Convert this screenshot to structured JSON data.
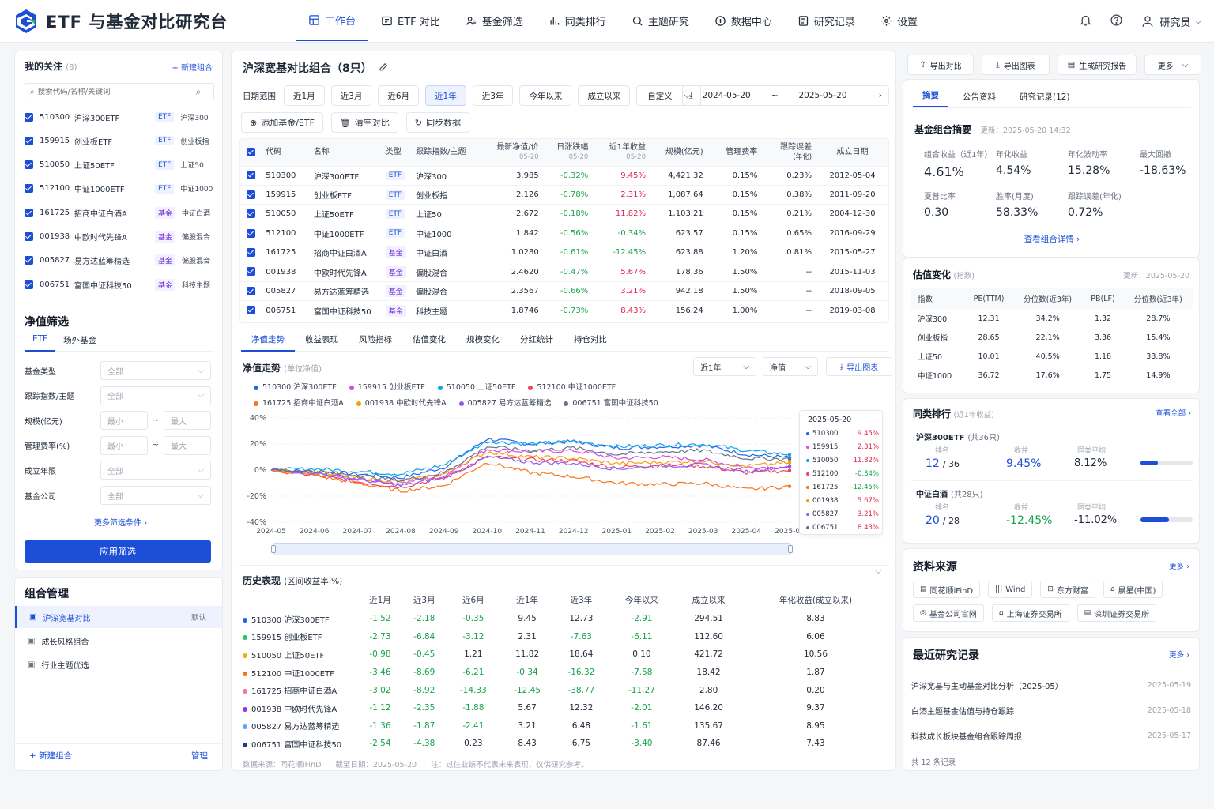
{
  "app": {
    "title": "ETF 与基金对比研究台"
  },
  "nav": [
    {
      "label": "工作台",
      "icon": "dashboard-icon",
      "active": true
    },
    {
      "label": "ETF 对比",
      "icon": "compare-icon"
    },
    {
      "label": "基金筛选",
      "icon": "filter-people-icon"
    },
    {
      "label": "同类排行",
      "icon": "bar-chart-icon"
    },
    {
      "label": "主题研究",
      "icon": "search-icon"
    },
    {
      "label": "数据中心",
      "icon": "database-icon"
    },
    {
      "label": "研究记录",
      "icon": "notebook-icon"
    },
    {
      "label": "设置",
      "icon": "gear-icon"
    }
  ],
  "user": {
    "name": "研究员"
  },
  "watchlist": {
    "title": "我的关注",
    "count": "(8)",
    "new_group": "+ 新建组合",
    "search_placeholder": "搜索代码/名称/关键词",
    "items": [
      {
        "code": "510300",
        "name": "沪深300ETF",
        "tag": "ETF",
        "kind": "etf",
        "index": "沪深300"
      },
      {
        "code": "159915",
        "name": "创业板ETF",
        "tag": "ETF",
        "kind": "etf",
        "index": "创业板指"
      },
      {
        "code": "510050",
        "name": "上证50ETF",
        "tag": "ETF",
        "kind": "etf",
        "index": "上证50"
      },
      {
        "code": "512100",
        "name": "中证1000ETF",
        "tag": "ETF",
        "kind": "etf",
        "index": "中证1000"
      },
      {
        "code": "161725",
        "name": "招商中证白酒A",
        "tag": "基金",
        "kind": "fund",
        "index": "中证白酒"
      },
      {
        "code": "001938",
        "name": "中欧时代先锋A",
        "tag": "基金",
        "kind": "fund",
        "index": "偏股混合"
      },
      {
        "code": "005827",
        "name": "易方达蓝筹精选",
        "tag": "基金",
        "kind": "fund",
        "index": "偏股混合"
      },
      {
        "code": "006751",
        "name": "富国中证科技50",
        "tag": "基金",
        "kind": "fund",
        "index": "科技主题"
      }
    ]
  },
  "filter": {
    "title": "净值筛选",
    "tabs": [
      "ETF",
      "场外基金"
    ],
    "rows": [
      {
        "label": "基金类型",
        "value": "全部"
      },
      {
        "label": "跟踪指数/主题",
        "value": "全部"
      },
      {
        "label": "规模(亿元)",
        "min": "最小",
        "max": "最大"
      },
      {
        "label": "管理费率(%)",
        "min": "最小",
        "max": "最大"
      },
      {
        "label": "成立年限",
        "value": "全部"
      },
      {
        "label": "基金公司",
        "value": "全部"
      }
    ],
    "more": "更多筛选条件 ›",
    "apply": "应用筛选",
    "range_sep": "~"
  },
  "groups": {
    "title": "组合管理",
    "items": [
      {
        "name": "沪深宽基对比",
        "badge": "默认",
        "active": true
      },
      {
        "name": "成长风格组合",
        "badge": ""
      },
      {
        "name": "行业主题优选",
        "badge": ""
      }
    ],
    "new": "+ 新建组合",
    "manage": "管理"
  },
  "main": {
    "title": "沪深宽基对比组合（8只）",
    "date_label": "日期范围",
    "ranges": [
      "近1月",
      "近3月",
      "近6月",
      "近1年",
      "近3年",
      "今年以来",
      "成立以来",
      "自定义"
    ],
    "active_range": 3,
    "date_from": "2024-05-20",
    "date_sep": "~",
    "date_to": "2025-05-20",
    "actions": [
      "添加基金/ETF",
      "清空对比",
      "同步数据"
    ],
    "table_headers": [
      "代码",
      "名称",
      "类型",
      "跟踪指数/主题",
      "最新净值/价",
      "日涨跌幅",
      "近1年收益",
      "规模(亿元)",
      "管理费率",
      "跟踪误差",
      "成立日期"
    ],
    "table_subheaders": {
      "nav": "05-20",
      "day": "05-20",
      "y1": "05-20",
      "te": "(年化)"
    },
    "rows": [
      {
        "code": "510300",
        "name": "沪深300ETF",
        "type": "ETF",
        "kind": "etf",
        "index": "沪深300",
        "nav": "3.985",
        "day": "-0.32%",
        "y1": "9.45%",
        "y1c": "up",
        "size": "4,421.32",
        "fee": "0.15%",
        "te": "0.23%",
        "date": "2012-05-04"
      },
      {
        "code": "159915",
        "name": "创业板ETF",
        "type": "ETF",
        "kind": "etf",
        "index": "创业板指",
        "nav": "2.126",
        "day": "-0.78%",
        "y1": "2.31%",
        "y1c": "up",
        "size": "1,087.64",
        "fee": "0.15%",
        "te": "0.38%",
        "date": "2011-09-20"
      },
      {
        "code": "510050",
        "name": "上证50ETF",
        "type": "ETF",
        "kind": "etf",
        "index": "上证50",
        "nav": "2.672",
        "day": "-0.18%",
        "y1": "11.82%",
        "y1c": "up",
        "size": "1,103.21",
        "fee": "0.15%",
        "te": "0.21%",
        "date": "2004-12-30"
      },
      {
        "code": "512100",
        "name": "中证1000ETF",
        "type": "ETF",
        "kind": "etf",
        "index": "中证1000",
        "nav": "1.842",
        "day": "-0.56%",
        "y1": "-0.34%",
        "y1c": "down",
        "size": "623.57",
        "fee": "0.15%",
        "te": "0.65%",
        "date": "2016-09-29"
      },
      {
        "code": "161725",
        "name": "招商中证白酒A",
        "type": "基金",
        "kind": "fund",
        "index": "中证白酒",
        "nav": "1.0280",
        "day": "-0.61%",
        "y1": "-12.45%",
        "y1c": "down",
        "size": "623.88",
        "fee": "1.20%",
        "te": "0.81%",
        "date": "2015-05-27"
      },
      {
        "code": "001938",
        "name": "中欧时代先锋A",
        "type": "基金",
        "kind": "fund",
        "index": "偏股混合",
        "nav": "2.4620",
        "day": "-0.47%",
        "y1": "5.67%",
        "y1c": "up",
        "size": "178.36",
        "fee": "1.50%",
        "te": "--",
        "date": "2015-11-03"
      },
      {
        "code": "005827",
        "name": "易方达蓝筹精选",
        "type": "基金",
        "kind": "fund",
        "index": "偏股混合",
        "nav": "2.3567",
        "day": "-0.66%",
        "y1": "3.21%",
        "y1c": "up",
        "size": "942.18",
        "fee": "1.50%",
        "te": "--",
        "date": "2018-09-05"
      },
      {
        "code": "006751",
        "name": "富国中证科技50",
        "type": "基金",
        "kind": "fund",
        "index": "科技主题",
        "nav": "1.8746",
        "day": "-0.73%",
        "y1": "8.43%",
        "y1c": "up",
        "size": "156.24",
        "fee": "1.00%",
        "te": "--",
        "date": "2019-03-08"
      }
    ],
    "subtabs": [
      "净值走势",
      "收益表现",
      "风险指标",
      "估值变化",
      "规模变化",
      "分红统计",
      "持仓对比"
    ],
    "chart_title": "净值走势",
    "chart_unit": "(单位净值)",
    "chart_period": "近1年",
    "chart_mode": "净值",
    "export_chart": "导出图表",
    "tooltip_date": "2025-05-20",
    "history_title": "历史表现",
    "history_unit": "(区间收益率 %)",
    "history_headers": [
      "近1月",
      "近3月",
      "近6月",
      "近1年",
      "近3年",
      "今年以来",
      "成立以来",
      "年化收益(成立以来)"
    ],
    "history_rows": [
      {
        "name": "510300 沪深300ETF",
        "color": "#2563eb",
        "v": [
          "-1.52",
          "-2.18",
          "-0.35",
          "9.45",
          "12.73",
          "-2.91",
          "294.51",
          "8.83"
        ]
      },
      {
        "name": "159915 创业板ETF",
        "color": "#22c55e",
        "v": [
          "-2.73",
          "-6.84",
          "-3.12",
          "2.31",
          "-7.63",
          "-6.11",
          "112.60",
          "6.06"
        ]
      },
      {
        "name": "510050 上证50ETF",
        "color": "#eab308",
        "v": [
          "-0.98",
          "-0.45",
          "1.21",
          "11.82",
          "18.64",
          "0.10",
          "421.72",
          "10.56"
        ]
      },
      {
        "name": "512100 中证1000ETF",
        "color": "#f97316",
        "v": [
          "-3.46",
          "-8.69",
          "-6.21",
          "-0.34",
          "-16.32",
          "-7.58",
          "18.42",
          "1.87"
        ]
      },
      {
        "name": "161725 招商中证白酒A",
        "color": "#e879a8",
        "v": [
          "-3.02",
          "-8.92",
          "-14.33",
          "-12.45",
          "-38.77",
          "-11.27",
          "2.80",
          "0.20"
        ]
      },
      {
        "name": "001938 中欧时代先锋A",
        "color": "#9333ea",
        "v": [
          "-1.12",
          "-2.35",
          "-1.88",
          "5.67",
          "12.32",
          "-2.01",
          "146.20",
          "9.37"
        ]
      },
      {
        "name": "005827 易方达蓝筹精选",
        "color": "#60a5fa",
        "v": [
          "-1.36",
          "-1.87",
          "-2.41",
          "3.21",
          "6.48",
          "-1.61",
          "135.67",
          "8.95"
        ]
      },
      {
        "name": "006751 富国中证科技50",
        "color": "#1e3a8a",
        "v": [
          "-2.54",
          "-4.38",
          "0.23",
          "8.43",
          "6.75",
          "-3.40",
          "87.46",
          "7.43"
        ]
      }
    ],
    "footer": {
      "source": "数据来源：同花顺iFinD",
      "cutoff": "截至日期：2025-05-20",
      "note": "注：过往业绩不代表未来表现，仅供研究参考。"
    }
  },
  "chart_data": {
    "type": "line",
    "ylim": [
      -40,
      40
    ],
    "yticks": [
      "40%",
      "20%",
      "0%",
      "-20%",
      "-40%"
    ],
    "x_labels": [
      "2024-05",
      "2024-06",
      "2024-07",
      "2024-08",
      "2024-09",
      "2024-10",
      "2024-11",
      "2024-12",
      "2025-01",
      "2025-02",
      "2025-03",
      "2025-04",
      "2025-05"
    ],
    "series": [
      {
        "name": "510300 沪深300ETF",
        "short": "510300",
        "color": "#2563eb",
        "last": "9.45%",
        "lastc": "up",
        "values": [
          0,
          -1,
          -3,
          -6,
          2,
          24,
          20,
          22,
          17,
          18,
          19,
          12,
          9.45
        ]
      },
      {
        "name": "159915 创业板ETF",
        "short": "159915",
        "color": "#d946ef",
        "last": "2.31%",
        "lastc": "up",
        "values": [
          0,
          -3,
          -7,
          -10,
          -4,
          16,
          14,
          15,
          9,
          10,
          8,
          2,
          2.31
        ]
      },
      {
        "name": "510050 上证50ETF",
        "short": "510050",
        "color": "#0ea5e9",
        "last": "11.82%",
        "lastc": "up",
        "values": [
          0,
          1,
          -1,
          -3,
          4,
          22,
          20,
          22,
          18,
          19,
          20,
          15,
          11.82
        ]
      },
      {
        "name": "512100 中证1000ETF",
        "short": "512100",
        "color": "#f43f5e",
        "last": "-0.34%",
        "lastc": "down",
        "values": [
          0,
          -4,
          -9,
          -13,
          -6,
          10,
          8,
          7,
          2,
          4,
          3,
          -2,
          -0.34
        ]
      },
      {
        "name": "161725 招商中证白酒A",
        "short": "161725",
        "color": "#f97316",
        "last": "-12.45%",
        "lastc": "down",
        "values": [
          0,
          -4,
          -10,
          -16,
          -12,
          6,
          -2,
          -5,
          -10,
          -11,
          -10,
          -15,
          -12.45
        ]
      },
      {
        "name": "001938 中欧时代先锋A",
        "short": "001938",
        "color": "#f59e0b",
        "last": "5.67%",
        "lastc": "up",
        "values": [
          0,
          -2,
          -6,
          -9,
          -3,
          14,
          10,
          9,
          5,
          6,
          7,
          3,
          5.67
        ]
      },
      {
        "name": "005827 易方达蓝筹精选",
        "short": "005827",
        "color": "#8b5cf6",
        "last": "3.21%",
        "lastc": "up",
        "values": [
          0,
          -2,
          -7,
          -12,
          -6,
          10,
          6,
          5,
          1,
          3,
          4,
          -1,
          3.21
        ]
      },
      {
        "name": "006751 富国中证科技50",
        "short": "006751",
        "color": "#64748b",
        "last": "8.43%",
        "lastc": "up",
        "values": [
          0,
          -1,
          -4,
          -8,
          -2,
          18,
          15,
          17,
          12,
          14,
          15,
          9,
          8.43
        ]
      }
    ]
  },
  "right": {
    "actions": [
      "导出对比",
      "导出图表",
      "生成研究报告",
      "更多"
    ],
    "tabs": [
      "摘要",
      "公告资料",
      "研究记录(12)"
    ],
    "summary": {
      "title": "基金组合摘要",
      "updated": "更新：2025-05-20 14:32",
      "metrics": [
        {
          "label": "组合收益（近1年）",
          "value": "4.61%",
          "c": "blue"
        },
        {
          "label": "年化收益",
          "value": "4.54%",
          "c": ""
        },
        {
          "label": "年化波动率",
          "value": "15.28%",
          "c": ""
        },
        {
          "label": "最大回撤",
          "value": "-18.63%",
          "c": "down"
        },
        {
          "label": "夏普比率",
          "value": "0.30",
          "c": ""
        },
        {
          "label": "胜率(月度)",
          "value": "58.33%",
          "c": ""
        },
        {
          "label": "跟踪误差(年化)",
          "value": "0.72%",
          "c": ""
        }
      ],
      "link": "查看组合详情 ›"
    },
    "valuation": {
      "title": "估值变化",
      "sub": "(指数)",
      "updated": "更新：2025-05-20",
      "headers": [
        "指数",
        "PE(TTM)",
        "分位数(近3年)",
        "PB(LF)",
        "分位数(近3年)"
      ],
      "rows": [
        [
          "沪深300",
          "12.31",
          "34.2%",
          "1.32",
          "28.7%"
        ],
        [
          "创业板指",
          "28.65",
          "22.1%",
          "3.36",
          "15.4%"
        ],
        [
          "上证50",
          "10.01",
          "40.5%",
          "1.18",
          "33.8%"
        ],
        [
          "中证1000",
          "36.72",
          "17.6%",
          "1.75",
          "14.9%"
        ]
      ]
    },
    "peer": {
      "title": "同类排行",
      "sub": "(近1年收益)",
      "all": "查看全部 ›",
      "items": [
        {
          "name": "沪深300ETF",
          "count": "(共36只)",
          "rank": "12",
          "total": "/ 36",
          "ret": "9.45%",
          "retc": "blue",
          "avg": "8.12%",
          "pct": 0.33
        },
        {
          "name": "中证白酒",
          "count": "(共28只)",
          "rank": "20",
          "total": "/ 28",
          "ret": "-12.45%",
          "retc": "down",
          "avg": "-11.02%",
          "pct": 0.55
        }
      ],
      "labels": {
        "rank": "排名",
        "ret": "收益",
        "avg": "同类平均"
      }
    },
    "sources": {
      "title": "资料来源",
      "more": "更多 ›",
      "items": [
        "同花顺iFinD",
        "Wind",
        "东方财富",
        "晨星(中国)",
        "基金公司官网",
        "上海证券交易所",
        "深圳证券交易所"
      ]
    },
    "records": {
      "title": "最近研究记录",
      "more": "更多 ›",
      "items": [
        {
          "title": "沪深宽基与主动基金对比分析（2025-05）",
          "date": "2025-05-19"
        },
        {
          "title": "白酒主题基金估值与持仓跟踪",
          "date": "2025-05-18"
        },
        {
          "title": "科技成长板块基金组合跟踪周报",
          "date": "2025-05-17"
        }
      ],
      "total": "共 12 条记录"
    }
  }
}
